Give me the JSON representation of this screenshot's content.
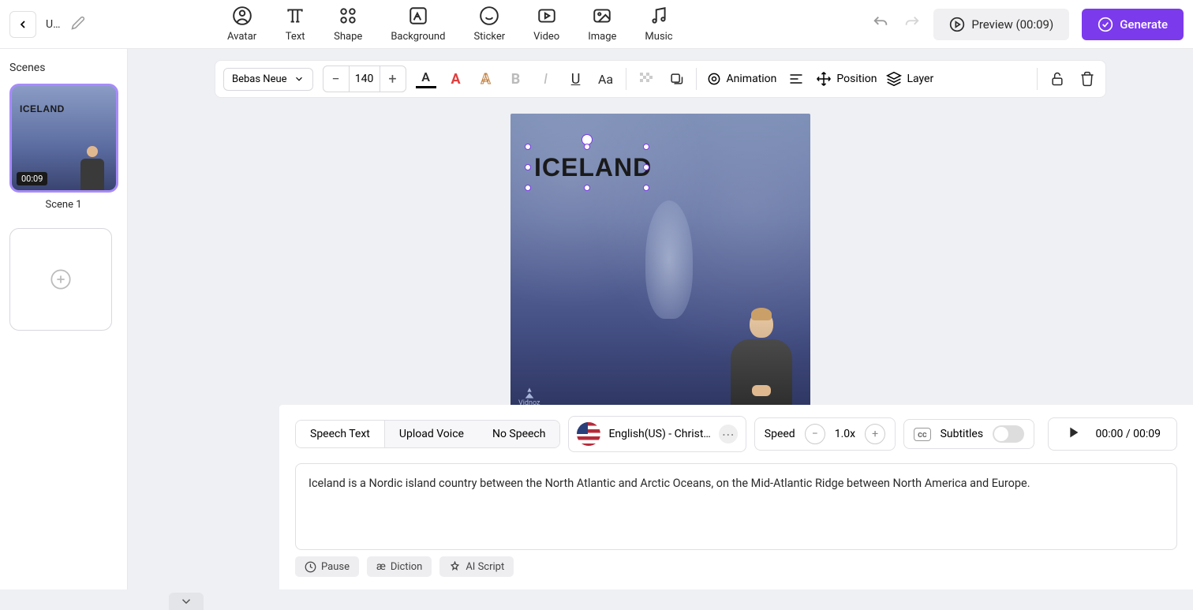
{
  "header": {
    "title": "U…",
    "tools": [
      {
        "label": "Avatar"
      },
      {
        "label": "Text"
      },
      {
        "label": "Shape"
      },
      {
        "label": "Background"
      },
      {
        "label": "Sticker"
      },
      {
        "label": "Video"
      },
      {
        "label": "Image"
      },
      {
        "label": "Music"
      }
    ],
    "preview_label": "Preview (00:09)",
    "generate_label": "Generate"
  },
  "sidebar": {
    "title": "Scenes",
    "scene_text": "ICELAND",
    "scene_time": "00:09",
    "scene_label": "Scene 1"
  },
  "text_toolbar": {
    "font": "Bebas Neue",
    "size": "140",
    "animation": "Animation",
    "position": "Position",
    "layer": "Layer"
  },
  "canvas": {
    "text": "ICELAND",
    "watermark": "Vidnoz"
  },
  "speech": {
    "tabs": {
      "speech_text": "Speech Text",
      "upload_voice": "Upload Voice",
      "no_speech": "No Speech"
    },
    "voice": "English(US) - Christ…",
    "speed_label": "Speed",
    "speed_value": "1.0x",
    "subtitle_label": "Subtitles",
    "cc": "cc",
    "time": "00:00 / 00:09",
    "content": "Iceland is a Nordic island country between the North Atlantic and Arctic Oceans, on the Mid-Atlantic Ridge between North America and Europe.",
    "pause": "Pause",
    "diction": "Diction",
    "ai_script": "AI Script"
  }
}
